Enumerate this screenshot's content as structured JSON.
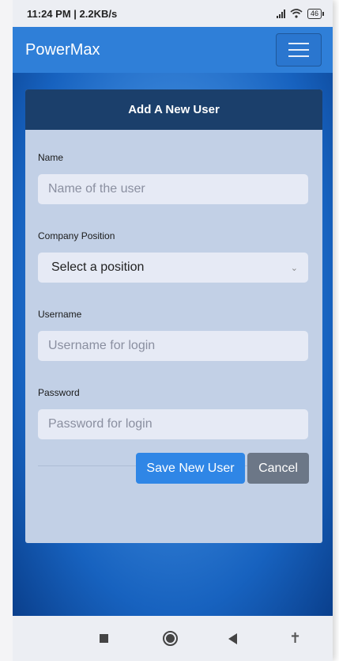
{
  "status_bar": {
    "time_speed": "11:24 PM | 2.2KB/s",
    "battery": "46"
  },
  "navbar": {
    "brand": "PowerMax",
    "menu_icon": "hamburger-menu-icon"
  },
  "form": {
    "title": "Add A New User",
    "fields": [
      {
        "label": "Name",
        "placeholder": "Name of the user"
      },
      {
        "label": "Company Position",
        "value": "Select a position"
      },
      {
        "label": "Username",
        "placeholder": "Username for login"
      },
      {
        "label": "Password",
        "placeholder": "Password for login"
      }
    ],
    "save_label": "Save New User",
    "cancel_label": "Cancel"
  },
  "colors": {
    "navbar": "#2f7fd8",
    "card_header": "#1b3f6b",
    "card_body": "#c2d0e6",
    "primary_button": "#2f86e6",
    "secondary_button": "#6c7787"
  },
  "system_nav": {
    "icons": [
      "recent-apps-icon",
      "home-icon",
      "back-icon",
      "accessibility-icon"
    ]
  }
}
